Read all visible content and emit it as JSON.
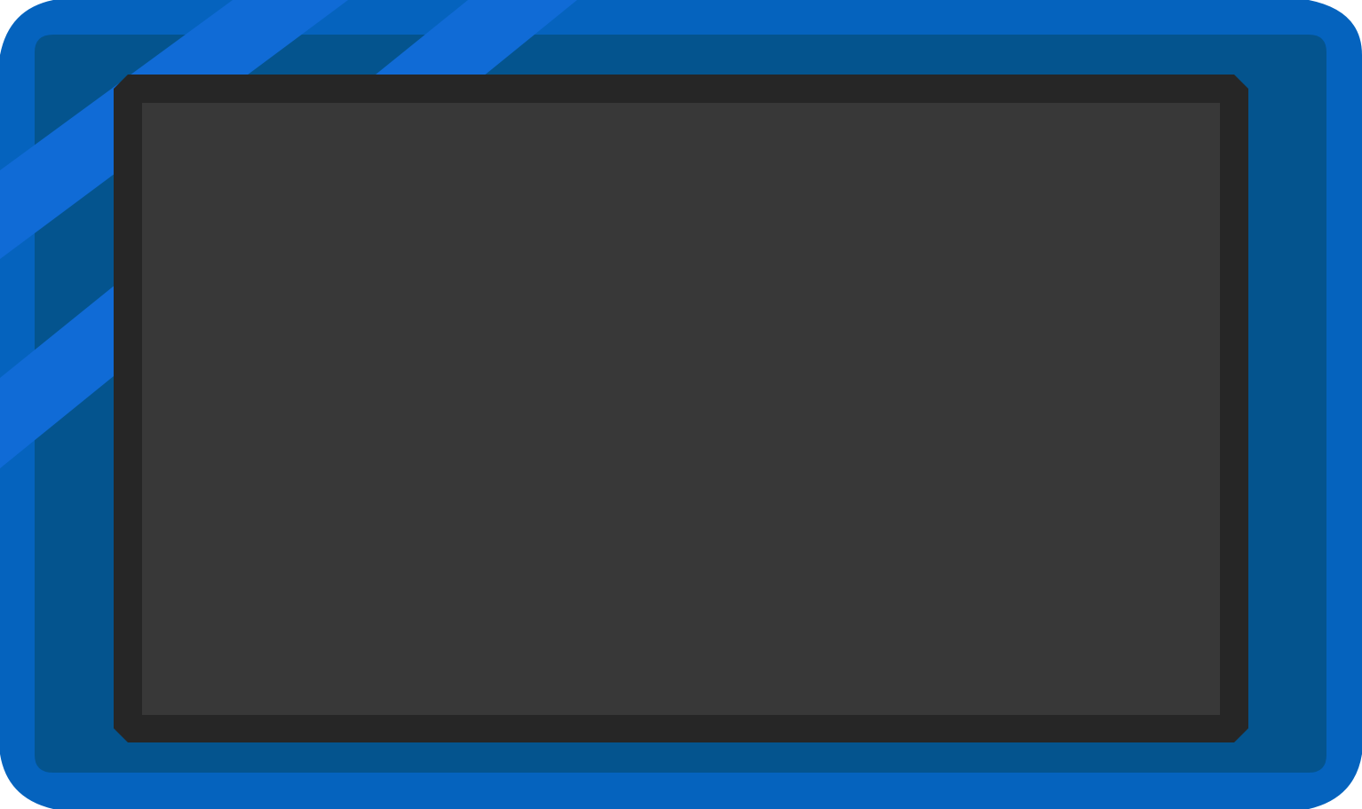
{
  "colors": {
    "outer_bezel": "#0563be",
    "inner_panel": "#04548e",
    "stripe": "#106bd6",
    "screen_frame": "#262626",
    "screen_surface": "#383838"
  },
  "icons": {
    "stripes": "decorative-diagonal-stripes-icon"
  }
}
